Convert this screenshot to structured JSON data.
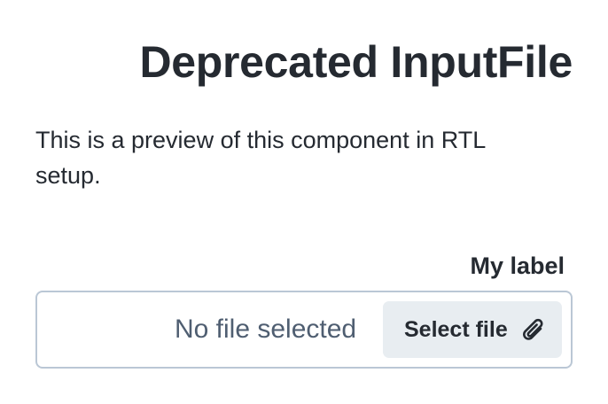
{
  "page": {
    "title": "Deprecated InputFile",
    "intro_line1": "This is a preview of this component in RTL",
    "intro_line2": ".setup"
  },
  "input_file": {
    "label": "My label",
    "status": "No file selected",
    "button_label": "Select file",
    "button_icon": "attachment-icon"
  },
  "colors": {
    "text": "#252a31",
    "muted_text": "#4f5e71",
    "border": "#bac7d5",
    "button_bg": "#e8edf1"
  }
}
